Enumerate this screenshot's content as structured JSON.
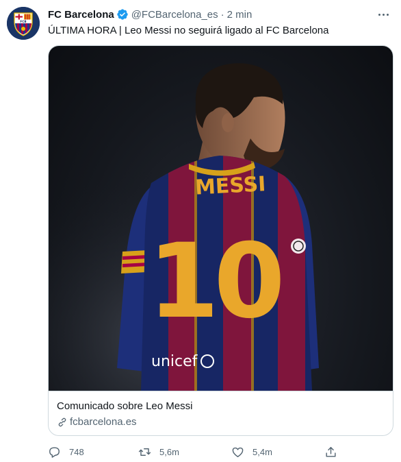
{
  "tweet": {
    "display_name": "FC Barcelona",
    "verified": true,
    "handle": "@FCBarcelona_es",
    "separator": "·",
    "time": "2 min",
    "text": "ÚLTIMA HORA | Leo Messi no seguirá ligado al FC Barcelona"
  },
  "avatar": {
    "icon": "fc-barcelona-crest-icon",
    "crest_letters": "FCB"
  },
  "card": {
    "image_icon": "messi-back-photo",
    "shirt_name": "MESSI",
    "shirt_number": "10",
    "sponsor": "unicef",
    "title": "Comunicado sobre Leo Messi",
    "domain": "fcbarcelona.es",
    "domain_icon": "link-icon"
  },
  "actions": {
    "reply": {
      "icon": "reply-icon",
      "count": "748"
    },
    "retweet": {
      "icon": "retweet-icon",
      "count": "5,6m"
    },
    "like": {
      "icon": "heart-icon",
      "count": "5,4m"
    },
    "share": {
      "icon": "share-icon"
    }
  },
  "colors": {
    "text": "#0f1419",
    "secondary": "#536471",
    "verified": "#1d9bf0",
    "border": "#cfd9de",
    "barca_blue": "#1d3a8a",
    "barca_red": "#a50044",
    "barca_gold": "#edbb00"
  }
}
